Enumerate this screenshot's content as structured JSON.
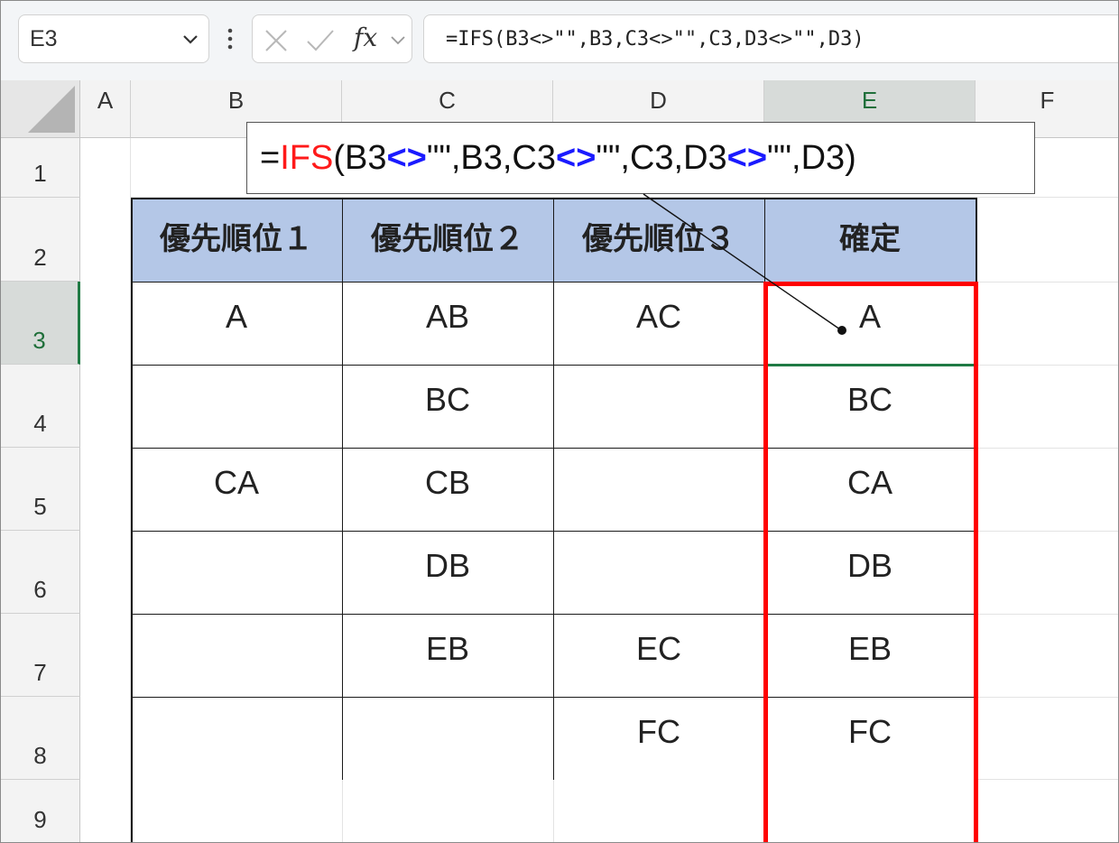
{
  "name_box": {
    "value": "E3"
  },
  "formula_bar": {
    "fx_label": "fx",
    "formula": "=IFS(B3<>\"\",B3,C3<>\"\",C3,D3<>\"\",D3)"
  },
  "columns": [
    "A",
    "B",
    "C",
    "D",
    "E",
    "F"
  ],
  "rows": [
    "1",
    "2",
    "3",
    "4",
    "5",
    "6",
    "7",
    "8",
    "9"
  ],
  "selected": {
    "column": "E",
    "row": "3"
  },
  "callout": {
    "parts": {
      "eq": "=",
      "fn": "IFS",
      "p1": "(B3",
      "op1": "<>",
      "p2": "\"\",B3,C3",
      "op2": "<>",
      "p3": "\"\",C3,D3",
      "op3": "<>",
      "p4": "\"\",D3)"
    }
  },
  "table": {
    "headers": [
      "優先順位１",
      "優先順位２",
      "優先順位３",
      "確定"
    ],
    "rows": [
      [
        "A",
        "AB",
        "AC",
        "A"
      ],
      [
        "",
        "BC",
        "",
        "BC"
      ],
      [
        "CA",
        "CB",
        "",
        "CA"
      ],
      [
        "",
        "DB",
        "",
        "DB"
      ],
      [
        "",
        "EB",
        "EC",
        "EB"
      ],
      [
        "",
        "",
        "FC",
        "FC"
      ]
    ]
  },
  "colors": {
    "highlight": "#ff0000",
    "header_fill": "#b4c7e7",
    "function": "#ff1a1a",
    "operator": "#1a1aff",
    "selection": "#1f7a44"
  }
}
